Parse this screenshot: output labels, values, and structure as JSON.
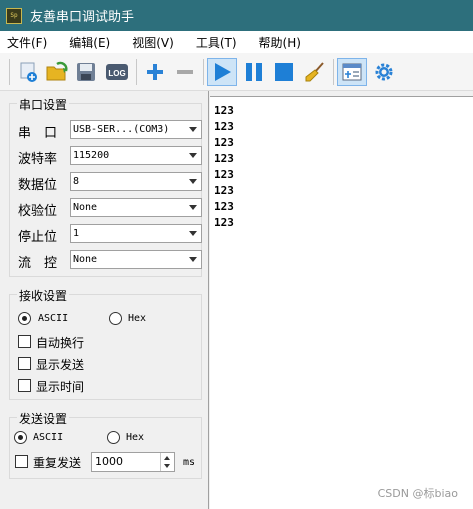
{
  "window": {
    "title": "友善串口调试助手",
    "icon_text": "Sp"
  },
  "menu": [
    "文件(F)",
    "编辑(E)",
    "视图(V)",
    "工具(T)",
    "帮助(H)"
  ],
  "toolbar": [
    {
      "name": "new-connection-button",
      "icon": "plus-document-icon"
    },
    {
      "name": "open-button",
      "icon": "folder-open-icon"
    },
    {
      "name": "save-button",
      "icon": "floppy-disk-icon"
    },
    {
      "name": "log-button",
      "icon": "log-icon",
      "text": "LOG"
    },
    {
      "name": "add-button",
      "icon": "plus-icon"
    },
    {
      "name": "remove-button",
      "icon": "minus-icon"
    },
    {
      "name": "start-button",
      "icon": "play-icon",
      "active": true
    },
    {
      "name": "pause-button",
      "icon": "pause-icon"
    },
    {
      "name": "stop-button",
      "icon": "stop-icon"
    },
    {
      "name": "clear-button",
      "icon": "broom-icon"
    },
    {
      "name": "layout-button",
      "icon": "window-layout-icon",
      "active": true
    },
    {
      "name": "settings-button",
      "icon": "gear-icon"
    }
  ],
  "serial": {
    "title": "串口设置",
    "rows": [
      {
        "label": "串　口",
        "value": "USB-SER...(COM3)"
      },
      {
        "label": "波特率",
        "value": "115200"
      },
      {
        "label": "数据位",
        "value": "8"
      },
      {
        "label": "校验位",
        "value": "None"
      },
      {
        "label": "停止位",
        "value": "1"
      },
      {
        "label": "流　控",
        "value": "None"
      }
    ]
  },
  "receive": {
    "title": "接收设置",
    "ascii": "ASCII",
    "hex": "Hex",
    "mode": "ascii",
    "auto_newline": "自动换行",
    "show_send": "显示发送",
    "show_time": "显示时间"
  },
  "send": {
    "title": "发送设置",
    "ascii": "ASCII",
    "hex": "Hex",
    "mode": "ascii",
    "repeat": "重复发送",
    "interval": "1000",
    "unit": "ms"
  },
  "output": {
    "lines": [
      "123",
      "123",
      "123",
      "123",
      "123",
      "123",
      "123",
      "123"
    ]
  },
  "watermark": "CSDN @标biao",
  "colors": {
    "titlebar": "#2d6f7c",
    "accent": "#1e7fd6"
  }
}
